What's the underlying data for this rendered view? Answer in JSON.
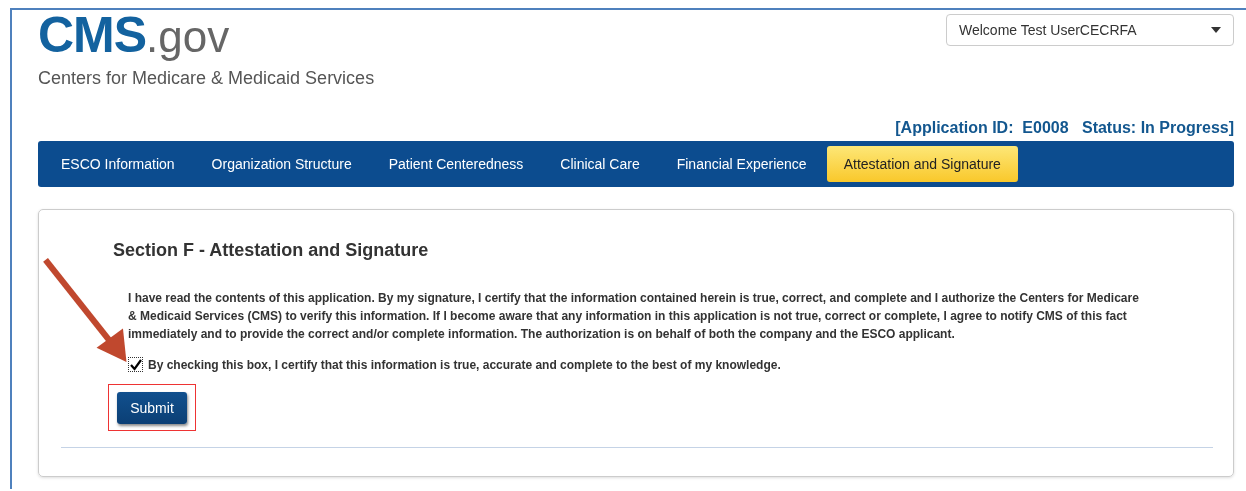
{
  "header": {
    "logo_main": "CMS",
    "logo_suffix": ".gov",
    "agency": "Centers for Medicare & Medicaid Services",
    "user_menu": "Welcome Test UserCECRFA",
    "application_status": "[Application ID:  E0008   Status: In Progress]"
  },
  "tabs": [
    {
      "label": "ESCO Information",
      "selected": false
    },
    {
      "label": "Organization Structure",
      "selected": false
    },
    {
      "label": "Patient Centeredness",
      "selected": false
    },
    {
      "label": "Clinical Care",
      "selected": false
    },
    {
      "label": "Financial Experience",
      "selected": false
    },
    {
      "label": "Attestation and Signature",
      "selected": true
    }
  ],
  "section": {
    "title": "Section F - Attestation and Signature",
    "statement": "I have read the contents of this application. By my signature, I certify that the information contained herein is true, correct, and complete and I authorize the Centers for Medicare & Medicaid Services (CMS) to verify this information. If I become aware that any information in this application is not true, correct or complete, I agree to notify CMS of this fact immediately and to provide the correct and/or complete information. The authorization is on behalf of both the company and the ESCO applicant.",
    "certify": {
      "label": "By checking this box, I certify that this information is true, accurate and complete to the best of my knowledge.",
      "checked": true
    },
    "submit": "Submit"
  }
}
